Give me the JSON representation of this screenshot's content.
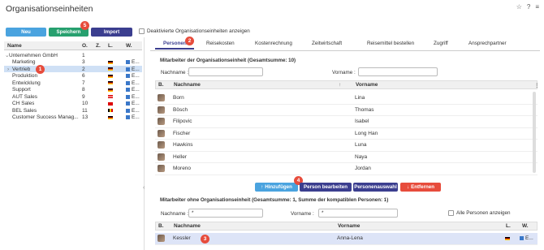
{
  "page_title": "Organisationseinheiten",
  "colors": {
    "teal": "#29b6b3",
    "green": "#27a06f",
    "navy": "#3b3e8f",
    "red": "#e74c3c",
    "blue": "#4aa3df"
  },
  "toolbar": {
    "neu": "Neu",
    "speichern": "Speichern",
    "import": "Import",
    "deactivated_label": "Deaktivierte Organisationseinheiten anzeigen",
    "badge": "5"
  },
  "tree": {
    "cols": [
      "Name",
      "O.",
      "Z.",
      "L.",
      "W."
    ],
    "rows": [
      {
        "name": "Unternehmen GmbH",
        "o": "1",
        "z": "",
        "flag": "",
        "w": ""
      },
      {
        "name": "Marketing",
        "o": "3",
        "z": "",
        "flag": "de",
        "w": "E..."
      },
      {
        "name": "Vertrieb",
        "o": "2",
        "z": "",
        "flag": "de",
        "w": "E..."
      },
      {
        "name": "Produktion",
        "o": "6",
        "z": "",
        "flag": "de",
        "w": "E..."
      },
      {
        "name": "Entwicklung",
        "o": "7",
        "z": "",
        "flag": "de",
        "w": "E..."
      },
      {
        "name": "Support",
        "o": "8",
        "z": "",
        "flag": "de",
        "w": "E..."
      },
      {
        "name": "AUT Sales",
        "o": "9",
        "z": "",
        "flag": "at",
        "w": "E..."
      },
      {
        "name": "CH Sales",
        "o": "10",
        "z": "",
        "flag": "ch",
        "w": "E..."
      },
      {
        "name": "BEL Sales",
        "o": "11",
        "z": "",
        "flag": "be",
        "w": "E..."
      },
      {
        "name": "Customer Success Manag...",
        "o": "13",
        "z": "",
        "flag": "de",
        "w": "E..."
      }
    ],
    "badge": "1"
  },
  "tabs": [
    "Personen",
    "Reisekosten",
    "Kostenrechnung",
    "Zeitwirtschaft",
    "Reisemittel bestellen",
    "Zugriff",
    "Ansprechpartner"
  ],
  "tab_badge": "2",
  "members": {
    "heading": "Mitarbeiter der Organisationseinheit (Gesamtsumme: 10)",
    "nachname_label": "Nachname :",
    "vorname_label": "Vorname :",
    "cols": [
      "B.",
      "Nachname",
      "Vorname"
    ],
    "rows": [
      {
        "nachname": "Born",
        "vorname": "Lina"
      },
      {
        "nachname": "Bösch",
        "vorname": "Thomas"
      },
      {
        "nachname": "Filipovic",
        "vorname": "Isabel"
      },
      {
        "nachname": "Fischer",
        "vorname": "Long Han"
      },
      {
        "nachname": "Hawkins",
        "vorname": "Luna"
      },
      {
        "nachname": "Heller",
        "vorname": "Naya"
      },
      {
        "nachname": "Moreno",
        "vorname": "Jordan"
      }
    ]
  },
  "actions": {
    "hinzufuegen": "Hinzufügen",
    "bearbeiten": "Person bearbeiten",
    "auswahl": "Personenauswahl",
    "entfernen": "Entfernen",
    "badge": "4"
  },
  "unassigned": {
    "heading": "Mitarbeiter ohne Organisationseinheit (Gesamtsumme: 1, Summe der kompatiblen Personen: 1)",
    "nachname_label": "Nachname :",
    "nachname_value": "*",
    "vorname_label": "Vorname :",
    "vorname_value": "*",
    "alle_label": "Alle Personen anzeigen",
    "cols": [
      "B.",
      "Nachname",
      "Vorname",
      "L.",
      "W."
    ],
    "rows": [
      {
        "nachname": "Kessler",
        "vorname": "Anna-Lena",
        "w": "E..."
      }
    ],
    "badge": "3"
  }
}
